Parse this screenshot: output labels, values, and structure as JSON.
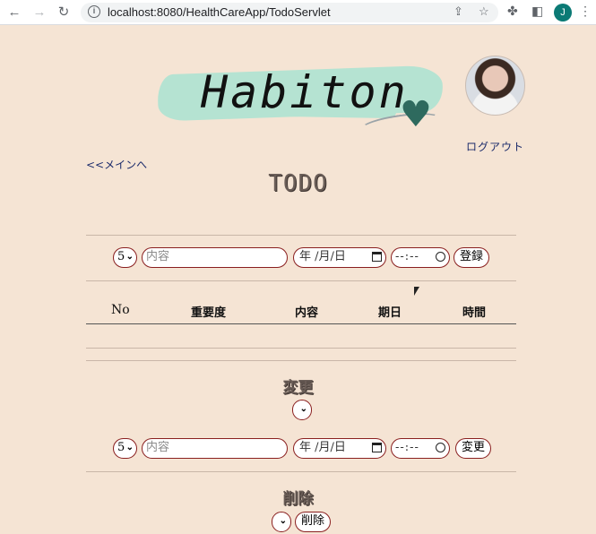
{
  "browser": {
    "url": "localhost:8080/HealthCareApp/TodoServlet",
    "profile_initial": "J"
  },
  "header": {
    "logo_text": "Habiton",
    "logout_label": "ログアウト",
    "back_label": "<<メインへ"
  },
  "page_title": "TODO",
  "add_form": {
    "priority": "5",
    "content_placeholder": "内容",
    "date_placeholder": "年 /月/日",
    "time_placeholder": "--:--",
    "submit_label": "登録"
  },
  "table": {
    "headers": [
      "No",
      "重要度",
      "内容",
      "期日",
      "時間"
    ],
    "rows": []
  },
  "edit_section": {
    "heading": "変更",
    "priority": "5",
    "content_placeholder": "内容",
    "date_placeholder": "年 /月/日",
    "time_placeholder": "--:--",
    "submit_label": "変更"
  },
  "delete_section": {
    "heading": "削除",
    "submit_label": "削除"
  },
  "colors": {
    "background": "#f5e4d4",
    "control_border": "#8a1f1f",
    "link": "#1a2a6a",
    "logo_brush": "#b5e3d2"
  }
}
